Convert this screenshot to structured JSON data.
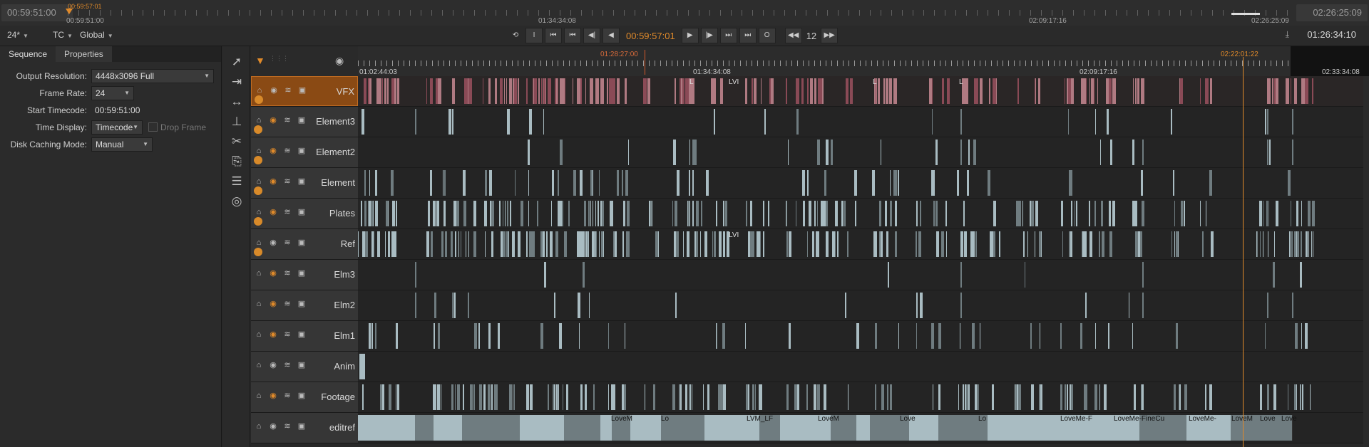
{
  "viewer": {
    "start_tc": "00:59:51:00",
    "end_tc": "02:26:25:09",
    "playhead_tc": "00:59:57:01",
    "in_tc": "00:59:51:00",
    "marks": [
      "01:34:34:08",
      "02:09:17:16",
      "02:26:25:09"
    ]
  },
  "toolbar": {
    "fps": "24*",
    "tc_mode": "TC",
    "scope": "Global",
    "current_tc": "00:59:57:01",
    "frame_increment": "12",
    "frame_zero": "0",
    "timecode_readout": "01:26:34:10",
    "btn_in": "I",
    "btn_out": "O"
  },
  "panel": {
    "tabs": [
      "Sequence",
      "Properties"
    ],
    "output_resolution_label": "Output Resolution:",
    "output_resolution_value": "4448x3096 Full",
    "frame_rate_label": "Frame Rate:",
    "frame_rate_value": "24",
    "start_timecode_label": "Start Timecode:",
    "start_timecode_value": "00:59:51:00",
    "time_display_label": "Time Display:",
    "time_display_value": "Timecode",
    "drop_frame_label": "Drop Frame",
    "disk_caching_label": "Disk Caching Mode:",
    "disk_caching_value": "Manual"
  },
  "ruler": {
    "left_tc": "01:02:44:03",
    "mid_tc": "01:34:34:08",
    "right_tc": "02:09:17:16",
    "far_right_tc": "02:33:34:08",
    "in_marker": "01:28:27:00",
    "playhead_marker": "02:22:01:22"
  },
  "tracks": [
    {
      "name": "VFX",
      "vfx": true
    },
    {
      "name": "Element3"
    },
    {
      "name": "Element2"
    },
    {
      "name": "Element"
    },
    {
      "name": "Plates"
    },
    {
      "name": "Ref"
    },
    {
      "name": "Elm3"
    },
    {
      "name": "Elm2"
    },
    {
      "name": "Elm1"
    },
    {
      "name": "Anim"
    },
    {
      "name": "Footage"
    },
    {
      "name": "editref"
    }
  ],
  "clip_labels": {
    "vfx": [
      "L",
      "LVI",
      "L",
      "L"
    ],
    "ref": [
      "LVI"
    ],
    "editref": [
      "LoveM",
      "Lo",
      "LVM_LF",
      "LoveM",
      "Love",
      "Lo",
      "LoveMe-F",
      "LoveMe-FineCu",
      "LoveMe-",
      "LoveM",
      "Love",
      "Love"
    ]
  },
  "colors": {
    "accent": "#e08a2a",
    "vfx_clip": "#8a4a56",
    "clip_light": "#a9bcc2",
    "clip_mid": "#6f7c80"
  },
  "icons": [
    "select-arrow-icon",
    "track-forward-icon",
    "slip-icon",
    "ripple-icon",
    "razor-icon",
    "slice-icon",
    "globe-icon",
    "lock-icon",
    "eye-icon",
    "stack-icon",
    "box-icon",
    "nuke-icon"
  ]
}
